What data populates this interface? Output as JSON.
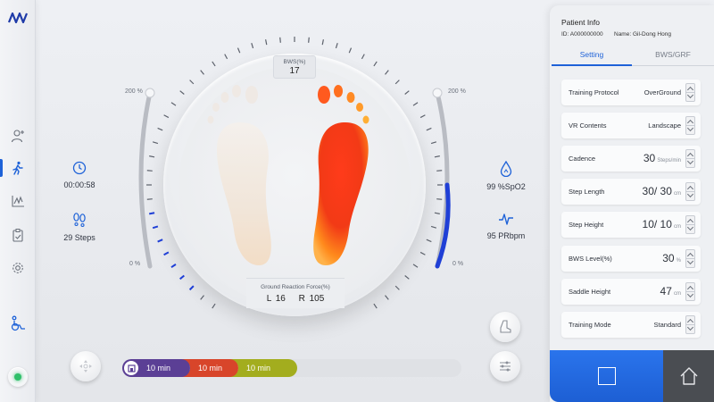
{
  "colors": {
    "accent": "#1e62d8",
    "gauge_blue": "#1f3fd6",
    "seg1": "#5b3f95",
    "seg2": "#d8452a",
    "seg3": "#a3ad1e",
    "home_bg": "#4a4d52"
  },
  "sidebar": {
    "icons": [
      "logo-icon",
      "patient-add-icon",
      "walking-icon",
      "chart-icon",
      "clipboard-icon",
      "settings-gear-icon",
      "wheelchair-icon",
      "power-icon"
    ],
    "active": "walking-icon"
  },
  "left_metrics": {
    "time": {
      "icon": "clock-icon",
      "value": "00:00:58"
    },
    "steps": {
      "icon": "footprints-icon",
      "value": "29 Steps"
    }
  },
  "right_metrics": {
    "spo2": {
      "icon": "blood-drop-icon",
      "value": "99 %SpO2"
    },
    "pulse": {
      "icon": "heartbeat-icon",
      "value": "95 PRbpm"
    }
  },
  "gauges": {
    "left": {
      "max_label": "200 %",
      "min_label": "0 %"
    },
    "right": {
      "max_label": "200 %",
      "min_label": "0 %",
      "fill_fraction": 0.3
    }
  },
  "dial": {
    "bws_label": "BWS(%)",
    "bws_value": "17",
    "grf_label": "Ground Reaction Force(%)",
    "left_value": "L 16",
    "right_value": "R 105"
  },
  "timeline": {
    "segments": [
      {
        "icon": "building-icon",
        "label": "10 min",
        "color": "#5b3f95"
      },
      {
        "icon": "stairs-icon",
        "label": "10 min",
        "color": "#d8452a"
      },
      {
        "icon": "slope-icon",
        "label": "10 min",
        "color": "#a3ad1e"
      }
    ]
  },
  "patient": {
    "title": "Patient Info",
    "id_text": "ID: A000000000",
    "name_text": "Name: Gil-Dong Hong"
  },
  "tabs": [
    {
      "label": "Setting",
      "active": true
    },
    {
      "label": "BWS/GRF",
      "active": false
    }
  ],
  "settings": [
    {
      "label": "Training Protocol",
      "value": "OverGround"
    },
    {
      "label": "VR Contents",
      "value": "Landscape"
    },
    {
      "label": "Cadence",
      "value": "30",
      "unit": "Steps/min"
    },
    {
      "label": "Step Length",
      "value": "30/ 30",
      "unit": "cm"
    },
    {
      "label": "Step Height",
      "value": "10/ 10",
      "unit": "cm"
    },
    {
      "label": "BWS Level(%)",
      "value": "30",
      "unit": "%"
    },
    {
      "label": "Saddle Height",
      "value": "47",
      "unit": "cm"
    },
    {
      "label": "Training Mode",
      "value": "Standard"
    }
  ]
}
